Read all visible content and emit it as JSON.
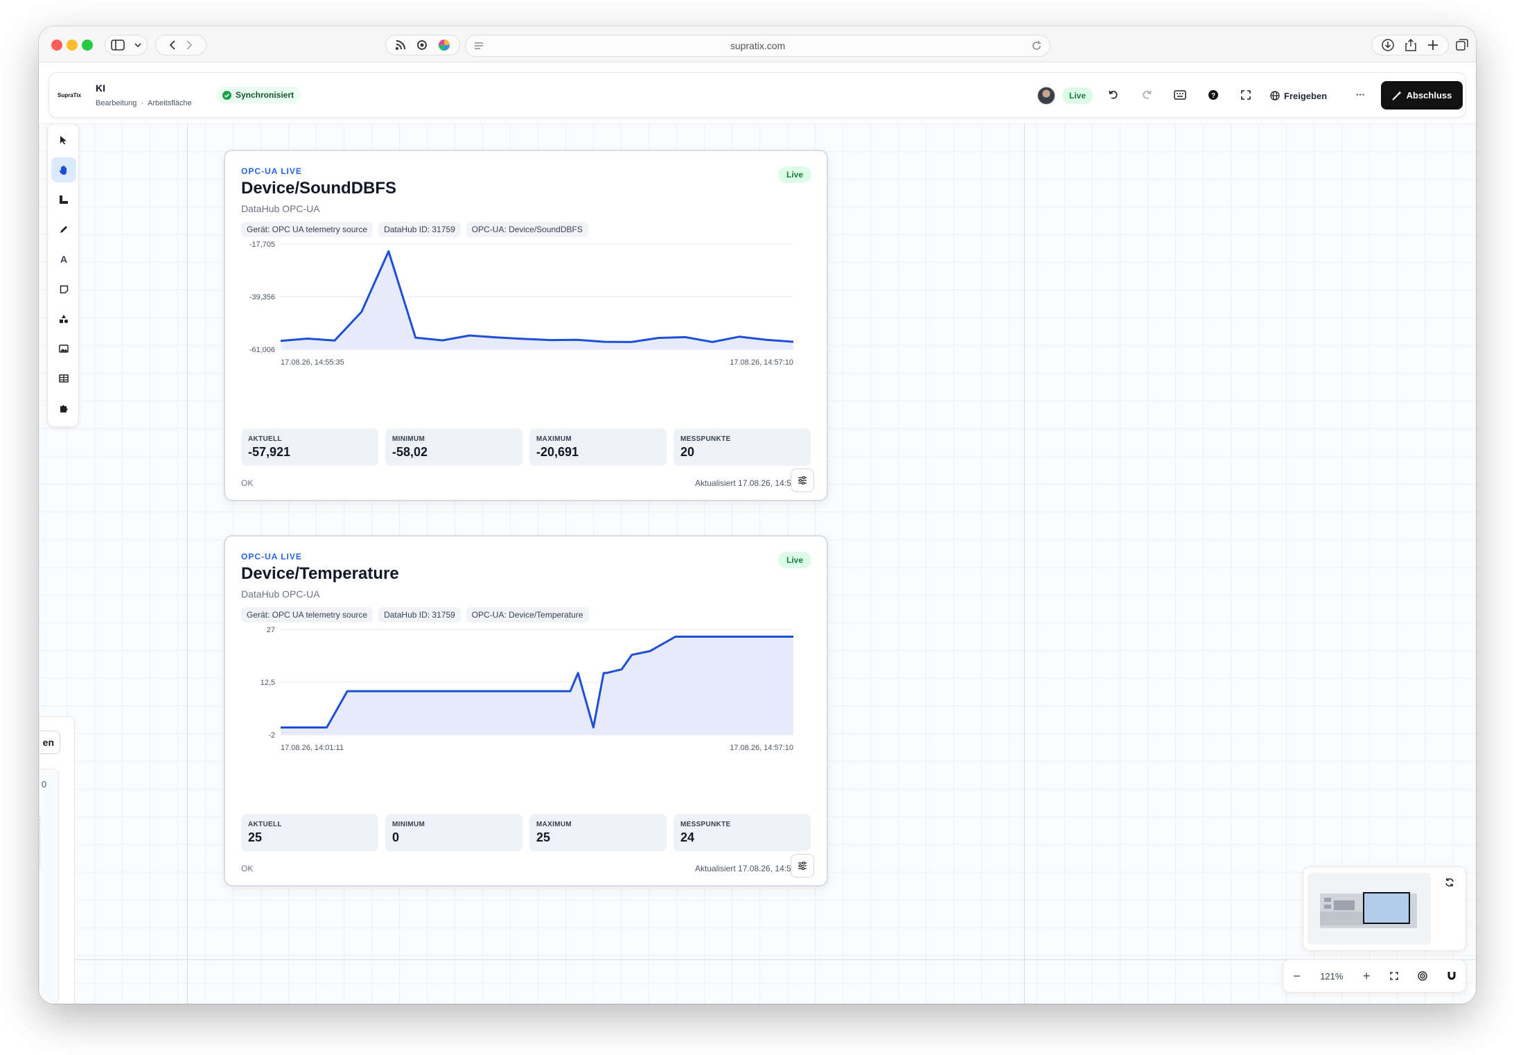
{
  "browser": {
    "url": "supratix.com"
  },
  "app": {
    "logo_text": "SupraTix",
    "doc_title": "KI",
    "breadcrumb": [
      "Bearbeitung",
      "Arbeitsfläche"
    ],
    "breadcrumb_sep": "·",
    "sync_status": "Synchronisiert",
    "live_badge": "Live",
    "share_label": "Freigeben",
    "more_label": "···",
    "finish_label": "Abschluss"
  },
  "tools": [
    "select-tool",
    "hand-tool",
    "ruler-tool",
    "pen-tool",
    "text-tool",
    "sticky-note-tool",
    "shapes-tool",
    "image-tool",
    "table-tool",
    "plugin-tool"
  ],
  "left_panel": {
    "button_fragment": "en",
    "value_fragment": "0"
  },
  "cards": [
    {
      "kicker": "OPC-UA LIVE",
      "title": "Device/SoundDBFS",
      "subtitle": "DataHub OPC-UA",
      "live": "Live",
      "chips": [
        "Gerät: OPC UA telemetry source",
        "DataHub ID: 31759",
        "OPC-UA: Device/SoundDBFS"
      ],
      "stats": [
        {
          "label": "AKTUELL",
          "value": "-57,921"
        },
        {
          "label": "MINIMUM",
          "value": "-58,02"
        },
        {
          "label": "MAXIMUM",
          "value": "-20,691"
        },
        {
          "label": "MESSPUNKTE",
          "value": "20"
        }
      ],
      "status": "OK",
      "updated": "Aktualisiert 17.08.26, 14:57:10"
    },
    {
      "kicker": "OPC-UA LIVE",
      "title": "Device/Temperature",
      "subtitle": "DataHub OPC-UA",
      "live": "Live",
      "chips": [
        "Gerät: OPC UA telemetry source",
        "DataHub ID: 31759",
        "OPC-UA: Device/Temperature"
      ],
      "stats": [
        {
          "label": "AKTUELL",
          "value": "25"
        },
        {
          "label": "MINIMUM",
          "value": "0"
        },
        {
          "label": "MAXIMUM",
          "value": "25"
        },
        {
          "label": "MESSPUNKTE",
          "value": "24"
        }
      ],
      "status": "OK",
      "updated": "Aktualisiert 17.08.26, 14:57:10"
    }
  ],
  "chart_data": [
    {
      "type": "area",
      "title": "Device/SoundDBFS",
      "ylim": [
        -61.006,
        -17.705
      ],
      "y_ticks": [
        "-17,705",
        "-39,356",
        "-61,006"
      ],
      "x_labels": [
        "17.08.26, 14:55:35",
        "17.08.26, 14:57:10"
      ],
      "values": [
        -57.5,
        -56.6,
        -57.4,
        -45.6,
        -20.7,
        -56.2,
        -57.3,
        -55.3,
        -56.1,
        -56.7,
        -57.2,
        -57.1,
        -57.9,
        -58.0,
        -56.3,
        -56.0,
        -58.0,
        -55.8,
        -57.1,
        -57.9
      ],
      "grid": true,
      "color": "#1d4ed8",
      "fill": "#e6eafa"
    },
    {
      "type": "area",
      "title": "Device/Temperature",
      "ylim": [
        -2,
        27
      ],
      "y_ticks": [
        "27",
        "12,5",
        "-2"
      ],
      "x_labels": [
        "17.08.26, 14:01:11",
        "17.08.26, 14:57:10"
      ],
      "values": [
        0,
        0,
        0,
        10,
        10,
        10,
        10,
        10,
        10,
        10,
        10,
        10,
        15,
        0,
        15,
        15,
        16,
        20,
        21,
        25,
        25,
        25,
        25,
        25
      ],
      "x_fractions": [
        0,
        0.045,
        0.09,
        0.13,
        0.17,
        0.25,
        0.35,
        0.45,
        0.5,
        0.52,
        0.555,
        0.565,
        0.58,
        0.61,
        0.63,
        0.635,
        0.665,
        0.685,
        0.72,
        0.77,
        0.83,
        0.9,
        0.95,
        1
      ],
      "grid": true,
      "color": "#1d4ed8",
      "fill": "#e6eafa"
    }
  ],
  "zoom": {
    "minus": "−",
    "level": "121%",
    "plus": "+"
  }
}
